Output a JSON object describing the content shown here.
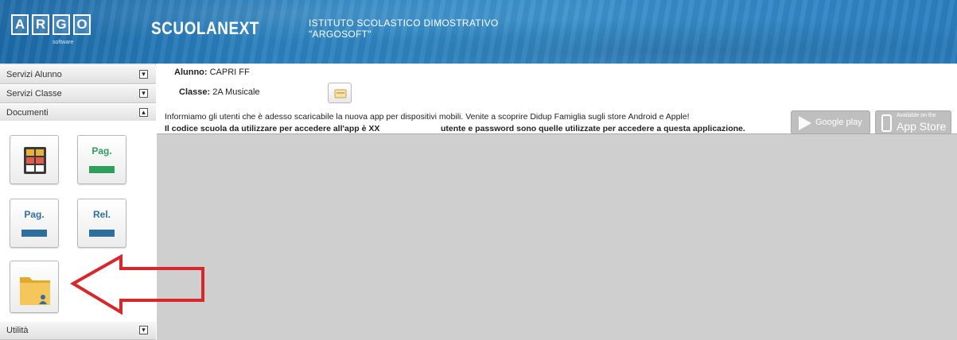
{
  "header": {
    "logo_letters": [
      "A",
      "R",
      "G",
      "O"
    ],
    "logo_sub": "software",
    "brand": "SCUOLANEXT",
    "institute_line1": "ISTITUTO SCOLASTICO DIMOSTRATIVO",
    "institute_line2": "\"ARGOSOFT\""
  },
  "sidebar": {
    "sections": [
      {
        "label": "Servizi Alunno",
        "toggle": "▾"
      },
      {
        "label": "Servizi Classe",
        "toggle": "▾"
      },
      {
        "label": "Documenti",
        "toggle": "▴"
      }
    ],
    "documents": {
      "pagella_label": "Pag.",
      "pagella2_label": "Pag.",
      "relazione_label": "Rel."
    },
    "bottom_section": {
      "label": "Utilità",
      "toggle": "▾"
    }
  },
  "main": {
    "student_label": "Alunno:",
    "student_value": "CAPRI FF",
    "class_label": "Classe:",
    "class_value": "2A Musicale",
    "notice_line1": "Informiamo gli utenti che è adesso scaricabile la nuova app per dispositivi mobili. Venite a scoprire Didup Famiglia sugli store Android e Apple!",
    "notice_line2_a": "Il codice scuola da utilizzare per accedere all'app è XX",
    "notice_line2_b": "utente e password sono quelle utilizzate per accedere a questa applicazione.",
    "google_play_label": "Google play",
    "app_store_small": "Available on the",
    "app_store_label": "App Store"
  },
  "colors": {
    "header_blue": "#2f86c4",
    "arrow_red": "#d9262a",
    "tile_green": "#2e9e5b",
    "tile_blue": "#2f6f9d",
    "folder_yellow": "#f2c14e"
  }
}
